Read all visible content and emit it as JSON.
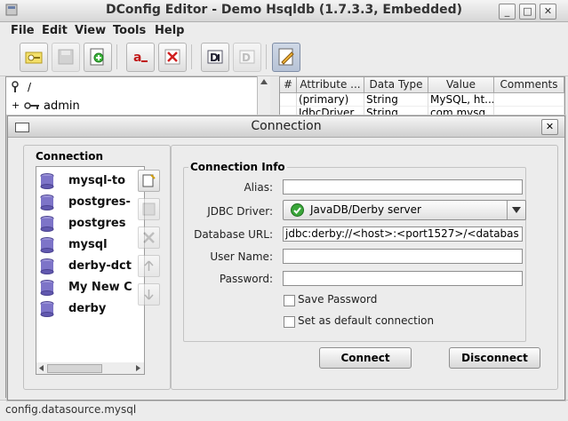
{
  "window": {
    "title": "DConfig Editor - Demo Hsqldb (1.7.3.3, Embedded)",
    "minimize": "_",
    "maximize": "□",
    "close": "✕"
  },
  "menu": [
    {
      "label": "File"
    },
    {
      "label": "Edit"
    },
    {
      "label": "View"
    },
    {
      "label": "Tools"
    },
    {
      "label": "Help"
    }
  ],
  "tree": {
    "root": "/",
    "child": "admin",
    "expander": "+"
  },
  "table": {
    "headers": [
      "#",
      "Attribute ...",
      "Data Type",
      "Value",
      "Comments"
    ],
    "rows": [
      [
        "",
        "(primary)",
        "String",
        "MySQL, ht...",
        ""
      ],
      [
        "",
        "JdbcDriver",
        "String",
        "com.mysq...",
        ""
      ]
    ]
  },
  "status": {
    "text": "config.datasource.mysql"
  },
  "dialog": {
    "title": "Connection",
    "close": "✕",
    "connection_label": "Connection",
    "connections": [
      "mysql-to",
      "postgres-",
      "postgres",
      "mysql",
      "derby-dct",
      "My New C",
      "derby"
    ],
    "info_label": "Connection Info",
    "fields": {
      "alias_label": "Alias:",
      "alias_value": "",
      "driver_label": "JDBC Driver:",
      "driver_value": "JavaDB/Derby server",
      "url_label": "Database URL:",
      "url_value": "jdbc:derby://<host>:<port1527>/<databas",
      "user_label": "User Name:",
      "user_value": "",
      "password_label": "Password:",
      "password_value": ""
    },
    "save_password": "Save Password",
    "set_default": "Set as default connection",
    "connect_button": "Connect",
    "disconnect_button": "Disconnect"
  }
}
